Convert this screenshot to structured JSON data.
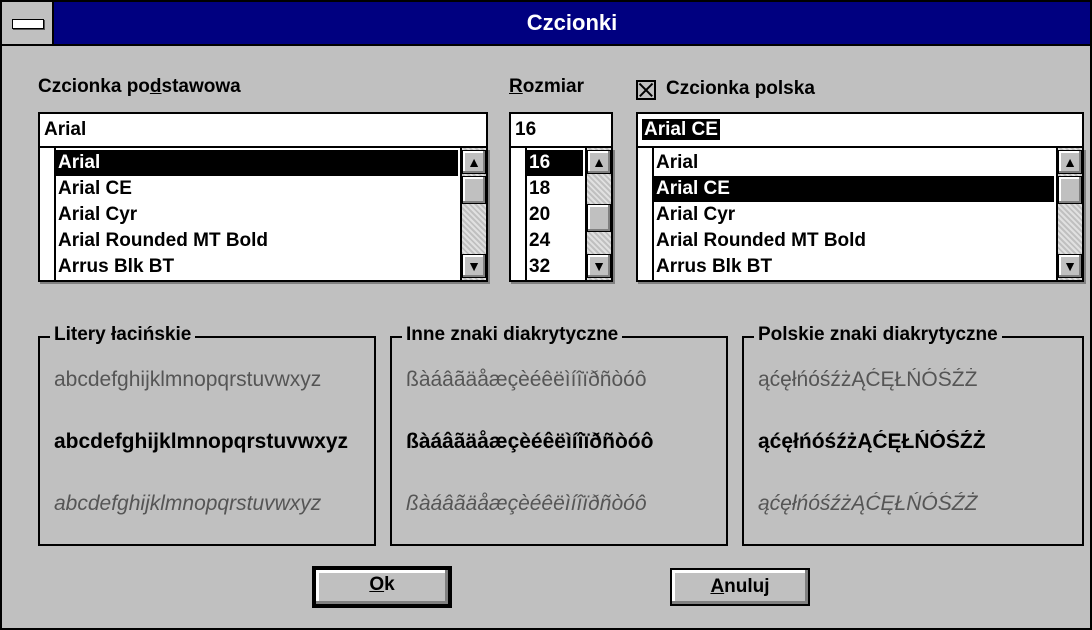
{
  "window": {
    "title": "Czcionki"
  },
  "base_font": {
    "label_pre": "Czcionka po",
    "label_u": "d",
    "label_post": "stawowa",
    "value": "Arial",
    "items": [
      "Arial",
      "Arial CE",
      "Arial Cyr",
      "Arial Rounded MT Bold",
      "Arrus Blk BT"
    ],
    "selected_index": 0
  },
  "size": {
    "label_u": "R",
    "label_post": "ozmiar",
    "value": "16",
    "items": [
      "16",
      "18",
      "20",
      "24",
      "32"
    ],
    "selected_index": 0
  },
  "polish_font": {
    "checkbox_label": "Czcionka polska",
    "checked": true,
    "value": "Arial CE",
    "items": [
      "Arial",
      "Arial CE",
      "Arial Cyr",
      "Arial Rounded MT Bold",
      "Arrus Blk BT"
    ],
    "selected_index": 1
  },
  "groups": {
    "latin": {
      "title": "Litery łacińskie",
      "normal": "abcdefghijklmnopqrstuvwxyz",
      "bold": "abcdefghijklmnopqrstuvwxyz",
      "italic": "abcdefghijklmnopqrstuvwxyz"
    },
    "other": {
      "title": "Inne znaki diakrytyczne",
      "normal": "ßàáâãäåæçèéêëìíîïðñòóô",
      "bold": "ßàáâãäåæçèéêëìíîïðñòóô",
      "italic": "ßàáâãäåæçèéêëìíîïðñòóô"
    },
    "polish": {
      "title": "Polskie znaki diakrytyczne",
      "normal": "ąćęłńóśźżĄĆĘŁŃÓŚŹŻ",
      "bold": "ąćęłńóśźżĄĆĘŁŃÓŚŹŻ",
      "italic": "ąćęłńóśźżĄĆĘŁŃÓŚŹŻ"
    }
  },
  "buttons": {
    "ok_u": "O",
    "ok_post": "k",
    "cancel_u": "A",
    "cancel_post": "nuluj"
  },
  "icons": {
    "scroll_up": "▲",
    "scroll_down": "▼"
  }
}
